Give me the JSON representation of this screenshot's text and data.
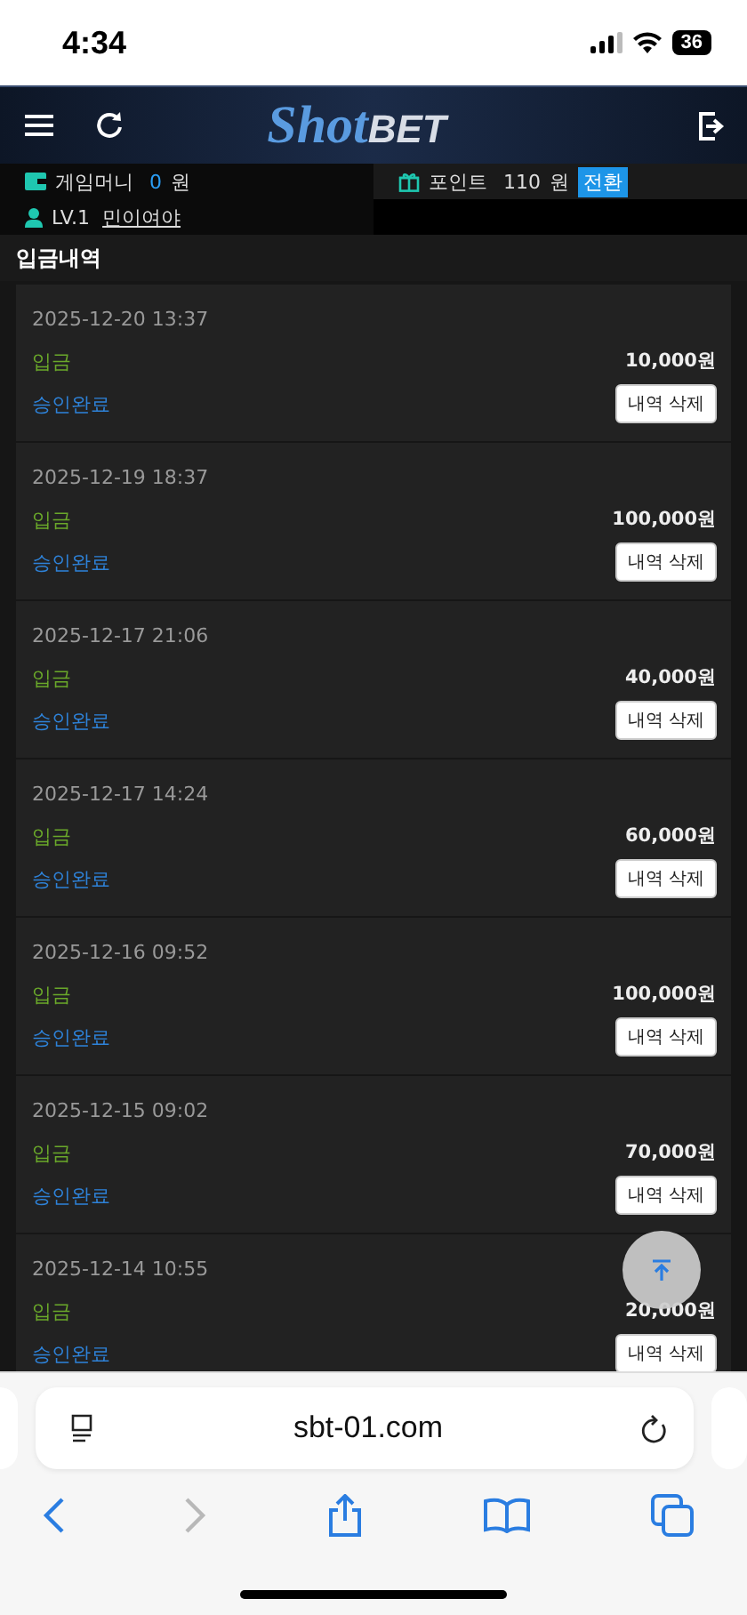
{
  "status_bar": {
    "time": "4:34",
    "battery": "36"
  },
  "header": {
    "logo_script": "Shot",
    "logo_bold": "BET"
  },
  "account": {
    "money_label": "게임머니",
    "money_value": "0",
    "money_unit": "원",
    "points_label": "포인트",
    "points_value": "110",
    "points_unit": "원",
    "convert_button": "전환",
    "level": "LV.1",
    "nickname": "민이여야"
  },
  "page_title": "입금내역",
  "deposits": [
    {
      "date": "2025-12-20 13:37",
      "type": "입금",
      "amount": "10,000원",
      "status": "승인완료",
      "delete_button": "내역 삭제"
    },
    {
      "date": "2025-12-19 18:37",
      "type": "입금",
      "amount": "100,000원",
      "status": "승인완료",
      "delete_button": "내역 삭제"
    },
    {
      "date": "2025-12-17 21:06",
      "type": "입금",
      "amount": "40,000원",
      "status": "승인완료",
      "delete_button": "내역 삭제"
    },
    {
      "date": "2025-12-17 14:24",
      "type": "입금",
      "amount": "60,000원",
      "status": "승인완료",
      "delete_button": "내역 삭제"
    },
    {
      "date": "2025-12-16 09:52",
      "type": "입금",
      "amount": "100,000원",
      "status": "승인완료",
      "delete_button": "내역 삭제"
    },
    {
      "date": "2025-12-15 09:02",
      "type": "입금",
      "amount": "70,000원",
      "status": "승인완료",
      "delete_button": "내역 삭제"
    },
    {
      "date": "2025-12-14 10:55",
      "type": "입금",
      "amount": "20,000원",
      "status": "승인완료",
      "delete_button": "내역 삭제"
    }
  ],
  "browser": {
    "url": "sbt-01.com",
    "forward_disabled": true
  }
}
